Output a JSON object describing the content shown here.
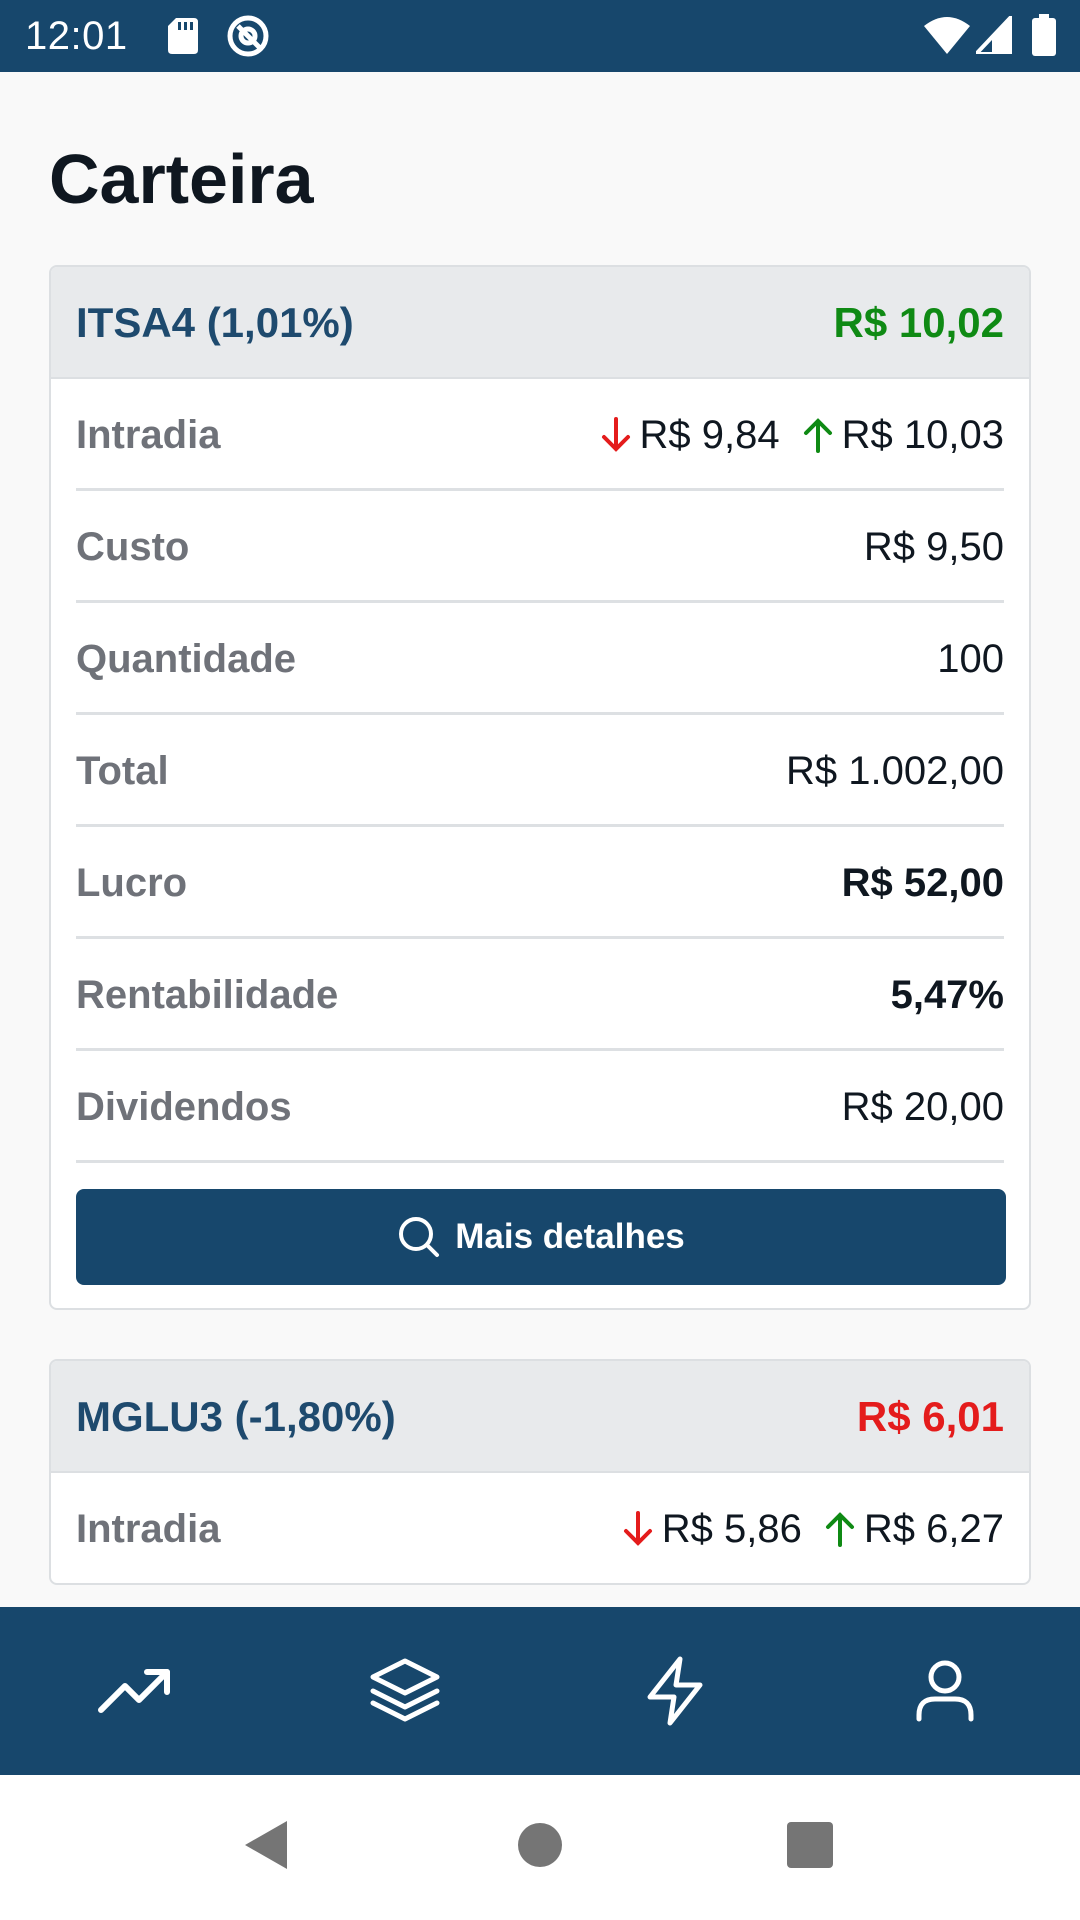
{
  "status_bar": {
    "time": "12:01",
    "left_icons": [
      "sd-card-icon",
      "at-sign-icon"
    ],
    "right_icons": [
      "wifi-icon",
      "cellular-signal-icon",
      "battery-icon"
    ]
  },
  "page": {
    "title": "Carteira"
  },
  "cards": [
    {
      "ticker": "ITSA4 (1,01%)",
      "price": "R$ 10,02",
      "price_color": "#0f8a14",
      "intraday_low": "R$ 9,84",
      "intraday_high": "R$ 10,03",
      "rows": {
        "intradia_label": "Intradia",
        "custo_label": "Custo",
        "custo_value": "R$ 9,50",
        "quantidade_label": "Quantidade",
        "quantidade_value": "100",
        "total_label": "Total",
        "total_value": "R$ 1.002,00",
        "lucro_label": "Lucro",
        "lucro_value": "R$ 52,00",
        "rentabilidade_label": "Rentabilidade",
        "rentabilidade_value": "5,47%",
        "dividendos_label": "Dividendos",
        "dividendos_value": "R$ 20,00"
      },
      "button_label": "Mais detalhes"
    },
    {
      "ticker": "MGLU3 (-1,80%)",
      "price": "R$ 6,01",
      "price_color": "#e41c1c",
      "intraday_low": "R$ 5,86",
      "intraday_high": "R$ 6,27",
      "rows": {
        "intradia_label": "Intradia"
      }
    }
  ],
  "bottom_nav": {
    "items": [
      "trending-up-icon",
      "layers-icon",
      "lightning-icon",
      "user-icon"
    ]
  },
  "system_nav": [
    "back-icon",
    "home-icon",
    "recents-icon"
  ],
  "colors": {
    "primary": "#17476c",
    "gain": "#0f8a14",
    "loss": "#e41c1c",
    "label": "#6f7279"
  }
}
